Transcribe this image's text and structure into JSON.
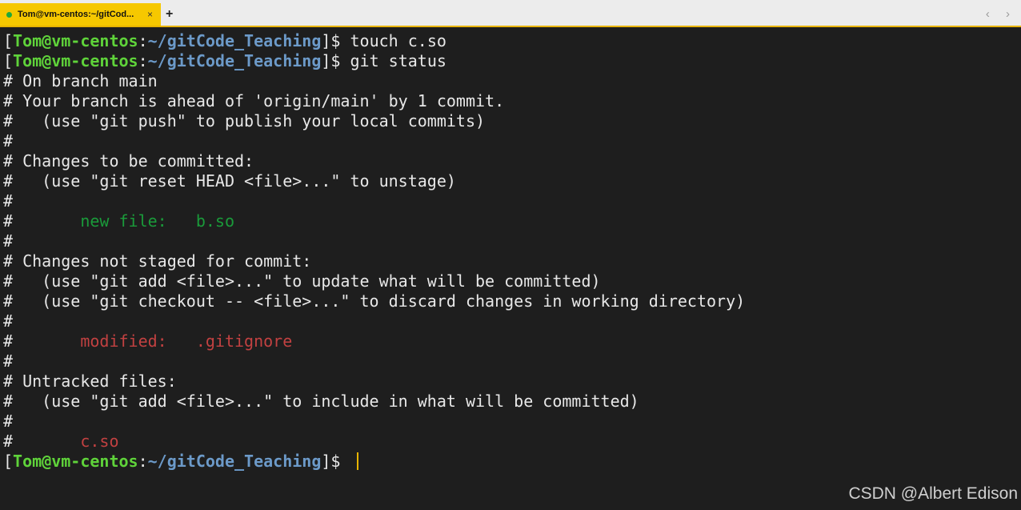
{
  "tab": {
    "title": "Tom@vm-centos:~/gitCod...",
    "close_glyph": "×",
    "new_tab_glyph": "+",
    "nav_glyphs": "‹ ›"
  },
  "prompt": {
    "open_bracket": "[",
    "user_host": "Tom@vm-centos",
    "colon": ":",
    "path": "~/gitCode_Teaching",
    "close": "]$ "
  },
  "commands": {
    "first": "touch c.so",
    "second": "git status"
  },
  "output": {
    "l01": "# On branch main",
    "l02": "# Your branch is ahead of 'origin/main' by 1 commit.",
    "l03": "#   (use \"git push\" to publish your local commits)",
    "l04": "#",
    "l05": "# Changes to be committed:",
    "l06": "#   (use \"git reset HEAD <file>...\" to unstage)",
    "l07": "#",
    "l08_prefix": "#       ",
    "l08_status": "new file:   b.so",
    "l09": "#",
    "l10": "# Changes not staged for commit:",
    "l11": "#   (use \"git add <file>...\" to update what will be committed)",
    "l12": "#   (use \"git checkout -- <file>...\" to discard changes in working directory)",
    "l13": "#",
    "l14_prefix": "#       ",
    "l14_status": "modified:   .gitignore",
    "l15": "#",
    "l16": "# Untracked files:",
    "l17": "#   (use \"git add <file>...\" to include in what will be committed)",
    "l18": "#",
    "l19_prefix": "#       ",
    "l19_status": "c.so"
  },
  "watermark": "CSDN @Albert Edison",
  "colors": {
    "tab_active": "#f6c800",
    "prompt_user": "#5fd33a",
    "prompt_path": "#6c9ac9",
    "staged": "#1a9b3a",
    "unstaged": "#c24141",
    "background": "#1e1e1e"
  }
}
